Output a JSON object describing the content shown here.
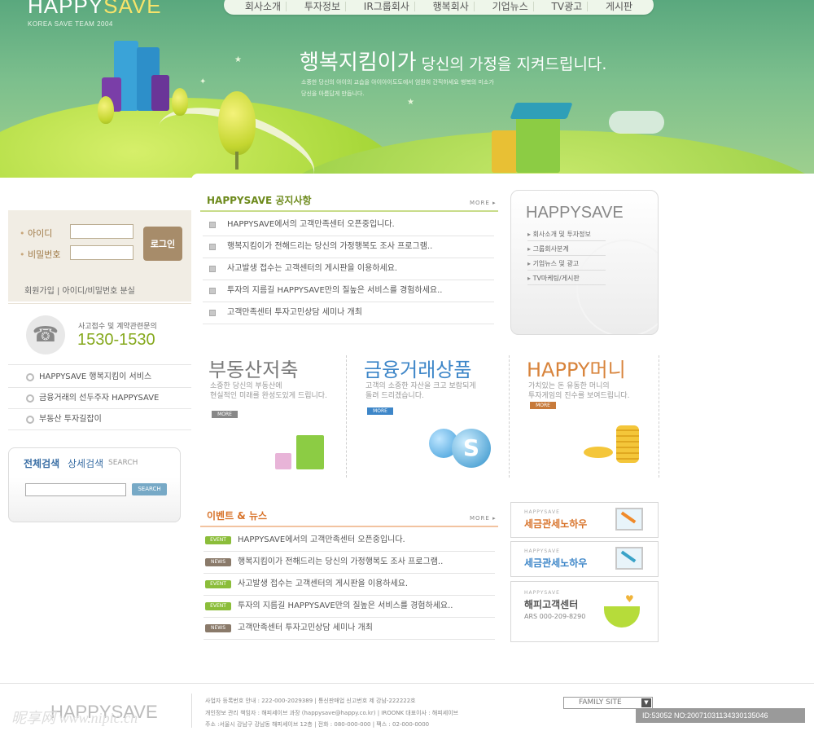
{
  "brand": {
    "logo_main": "HAPPY",
    "logo_accent": "SAVE",
    "tagline": "KOREA SAVE TEAM 2004"
  },
  "nav": {
    "items": [
      "회사소개",
      "투자정보",
      "IR그룹회사",
      "행복회사",
      "기업뉴스",
      "TV광고",
      "게시판"
    ]
  },
  "hero": {
    "title_main": "행복지킴이가",
    "title_rest": " 당신의 가정을 지켜드립니다.",
    "desc_line1": "소중한 당신의 아이의 교습을 아이아이도도에서 엄원히 간직하세요  행복의 미소가",
    "desc_line2": "당신을 아름답게 만듭니다."
  },
  "login": {
    "id_label": "아이디",
    "pw_label": "비밀번호",
    "button": "로그인",
    "links": "회원가입  |  아이디/비밀번호 분실"
  },
  "contact": {
    "label": "사고접수 및 계약관련문의",
    "number": "1530-1530"
  },
  "services": [
    "HAPPYSAVE 행복지킴이 서비스",
    "금융거래의 선두주자 HAPPYSAVE",
    "부동산 투자길잡이"
  ],
  "search": {
    "tab_all": "전체검색",
    "tab_detail": "상세검색",
    "tab_en": "SEARCH",
    "button": "SEARCH"
  },
  "notice": {
    "title": "HAPPYSAVE 공지사항",
    "more": "MORE",
    "items": [
      "HAPPYSAVE에서의 고객만족센터 오픈중입니다.",
      "행복지킴이가 전해드리는 당신의 가정행복도 조사 프로그램..",
      "사고발생 접수는 고객센터의 게시판을 이용하세요.",
      "투자의 지름길 HAPPYSAVE만의 질높은 서비스를 경험하세요..",
      "고객만족센터 투자고민상담 세미나 개최"
    ]
  },
  "products": [
    {
      "title": "부동산저축",
      "desc1": "소중한 당신의 부동산에",
      "desc2": "현실적인 미래를 완성도있게 드립니다.",
      "more": "MORE",
      "color": "#7a7a7a"
    },
    {
      "title": "금융거래상품",
      "desc1": "고객의 소중한 자산을 크고 보람되게",
      "desc2": "돌려 드리겠습니다.",
      "more": "MORE",
      "color": "#3d86c8"
    },
    {
      "title": "HAPPY머니",
      "desc1": "가치있는 돈 유동한 머니의",
      "desc2": "투자게임의 진수를 보여드립니다.",
      "more": "MORE",
      "color": "#d8843c"
    }
  ],
  "events": {
    "title": "이벤트 & 뉴스",
    "more": "MORE",
    "items": [
      {
        "tag": "EVENT",
        "text": "HAPPYSAVE에서의 고객만족센터 오픈중입니다."
      },
      {
        "tag": "NEWS",
        "text": "행복지킴이가 전해드리는 당신의 가정행복도 조사 프로그램.."
      },
      {
        "tag": "EVENT",
        "text": "사고발생 접수는 고객센터의 게시판을 이용하세요."
      },
      {
        "tag": "EVENT",
        "text": "투자의 지름길 HAPPYSAVE만의 질높은 서비스를 경험하세요.."
      },
      {
        "tag": "NEWS",
        "text": "고객만족센터 투자고민상담 세미나 개최"
      }
    ]
  },
  "side": {
    "title": "HAPPYSAVE",
    "links": [
      "회사소개 및 투자정보",
      "그룹회사분계",
      "기업뉴스 및 광고",
      "TV마케팅/게시판"
    ]
  },
  "banners": [
    {
      "small": "HAPPYSAVE",
      "title": "세금관세노하우",
      "color": "#d8732a"
    },
    {
      "small": "HAPPYSAVE",
      "title": "세금관세노하우",
      "color": "#3d86c8"
    },
    {
      "small": "HAPPYSAVE",
      "title": "해피고객센터",
      "sub": "ARS 000-209-8290",
      "color": "#555555"
    }
  ],
  "footer": {
    "logo": "HAPPYSAVE",
    "line1": "사업자 등록번호 안내 : 222-000-2029389  |  통신판매업 신고번호 제 강남-222222호",
    "line2": "개인정보 관리 책임자 : 해피세이브 과장 (happysave@happy.co.kr)  |  IROONK 대표이사 : 해피세이브",
    "line3": "주소 :서울시 강남구 강남동 해피세이브 12층  |  전화 : 080-000-000  |  팩스 : 02-000-0000",
    "family_site": "FAMILY SITE",
    "watermark": "昵享网 www.nipic.cn",
    "image_id": "ID:53052 NO:20071031134330135046"
  },
  "colors": {
    "accent_green": "#86a91e",
    "notice_title": "#6d8a1c",
    "event_title": "#d8732a",
    "event_tag": "#8bbd3a",
    "news_tag": "#8a7a6a"
  }
}
